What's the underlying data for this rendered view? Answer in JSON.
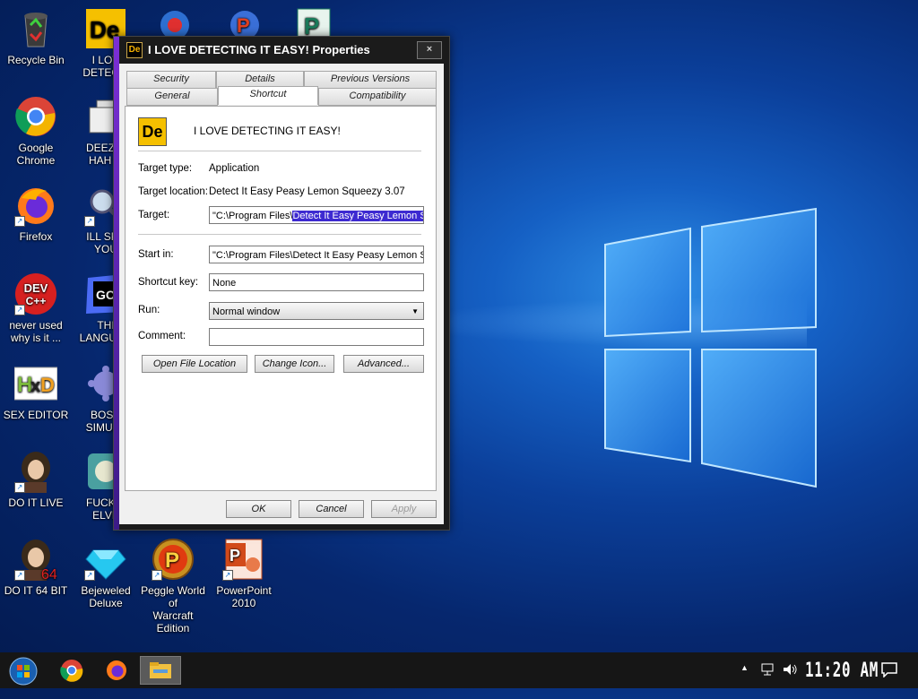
{
  "desktop": {
    "icons": [
      {
        "label": "Recycle Bin"
      },
      {
        "label": "I LOV\nDETECTI"
      },
      {
        "label": "Google Chrome"
      },
      {
        "label": "DEEZ N\nHAH G"
      },
      {
        "label": "Firefox"
      },
      {
        "label": "ILL SPY\nYOU"
      },
      {
        "label": "never used\nwhy is it ..."
      },
      {
        "label": "THI\nLANGUAG"
      },
      {
        "label": "SEX EDITOR"
      },
      {
        "label": "BOSN\nSIMULA"
      },
      {
        "label": "DO IT LIVE"
      },
      {
        "label": "FUCK S\nELVE"
      },
      {
        "label": "DO IT 64 BIT"
      },
      {
        "label": "Bejeweled\nDeluxe"
      },
      {
        "label": "Peggle World of\nWarcraft Edition"
      },
      {
        "label": "PowerPoint\n2010"
      }
    ]
  },
  "dialog": {
    "title": "I LOVE DETECTING IT EASY! Properties",
    "close_symbol": "×",
    "tabs_back": [
      "Security",
      "Details",
      "Previous Versions"
    ],
    "tabs_front": [
      "General",
      "Shortcut",
      "Compatibility"
    ],
    "active_tab": "Shortcut",
    "app_icon_text": "De",
    "name": "I LOVE DETECTING IT EASY!",
    "target_type_label": "Target type:",
    "target_type_value": "Application",
    "target_location_label": "Target location:",
    "target_location_value": "Detect It Easy Peasy Lemon Squeezy 3.07",
    "target_label": "Target:",
    "target_value_prefix": "\"C:\\Program Files\\",
    "target_value_selected": "Detect It Easy Peasy Lemon Sq",
    "start_in_label": "Start in:",
    "start_in_value": "\"C:\\Program Files\\Detect It Easy Peasy Lemon Sq",
    "shortcut_key_label": "Shortcut key:",
    "shortcut_key_value": "None",
    "run_label": "Run:",
    "run_value": "Normal window",
    "comment_label": "Comment:",
    "comment_value": "",
    "btn_open_location": "Open File Location",
    "btn_change_icon": "Change Icon...",
    "btn_advanced": "Advanced...",
    "btn_ok": "OK",
    "btn_cancel": "Cancel",
    "btn_apply": "Apply"
  },
  "taskbar": {
    "clock": "11:20 AM"
  },
  "colors": {
    "selection": "#3d2ad1",
    "accent": "#7b2fd6"
  }
}
